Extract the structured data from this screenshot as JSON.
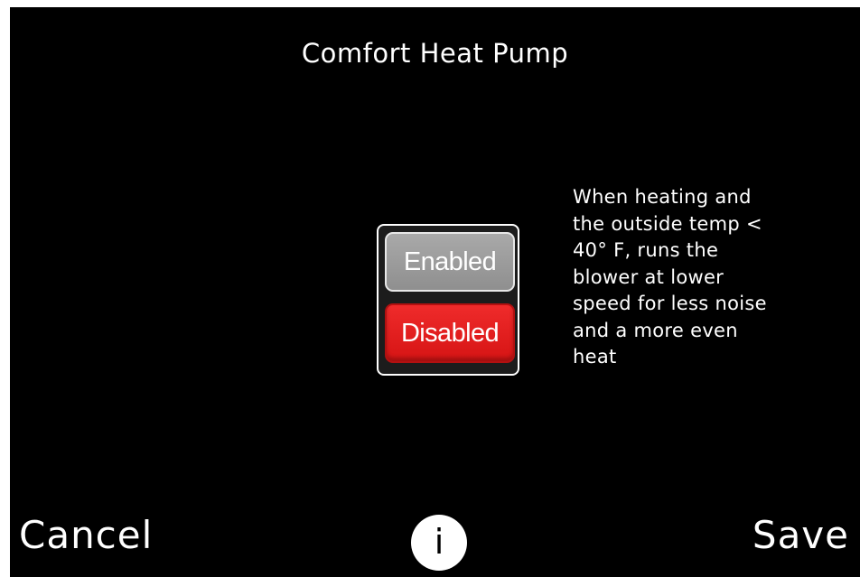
{
  "header": {
    "title": "Comfort Heat Pump"
  },
  "toggle": {
    "options": [
      {
        "label": "Enabled",
        "selected": false
      },
      {
        "label": "Disabled",
        "selected": true
      }
    ]
  },
  "description": "When heating and\nthe outside temp <\n40° F, runs the\nblower at lower\nspeed for less noise\nand a more even\nheat",
  "footer": {
    "cancel_label": "Cancel",
    "info_icon": "i",
    "save_label": "Save"
  },
  "colors": {
    "background": "#000000",
    "selected": "#e41c1c",
    "unselected": "#9a9a9a",
    "text": "#ffffff"
  }
}
